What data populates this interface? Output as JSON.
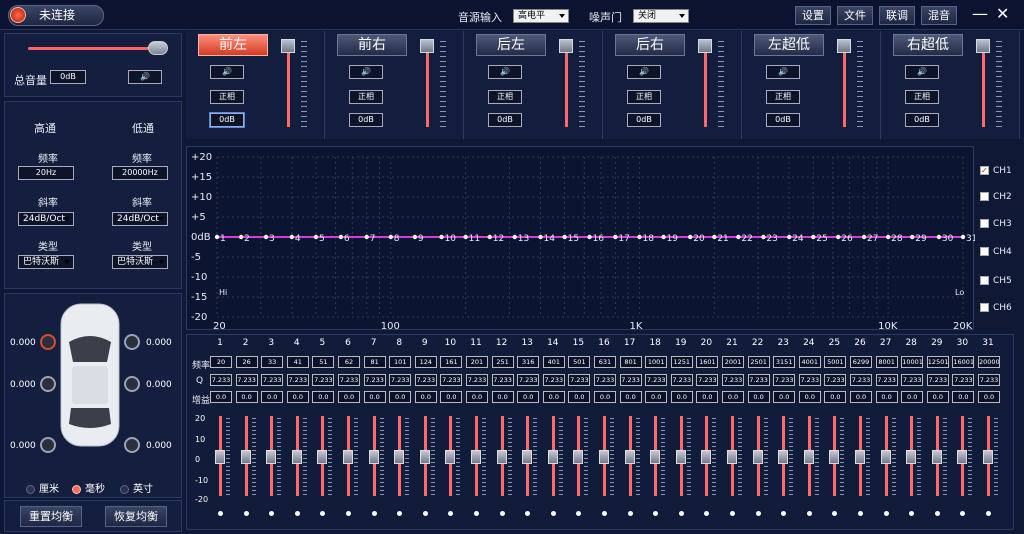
{
  "top": {
    "connection_label": "未连接",
    "source_label": "音源输入",
    "source_value": "高电平",
    "noise_label": "噪声门",
    "noise_value": "关闭",
    "buttons": [
      "设置",
      "文件",
      "联调",
      "混音"
    ],
    "minimize": "—",
    "close": "✕"
  },
  "volume": {
    "label": "总音量",
    "value": "0dB",
    "level_pct": 100
  },
  "crossover": {
    "high_title": "高通",
    "low_title": "低通",
    "freq_label": "频率",
    "high_freq": "20Hz",
    "low_freq": "20000Hz",
    "slope_label": "斜率",
    "high_slope": "24dB/Oct",
    "low_slope": "24dB/Oct",
    "type_label": "类型",
    "high_type": "巴特沃斯",
    "low_type": "巴特沃斯"
  },
  "channels": [
    {
      "name": "前左",
      "phase": "正相",
      "gain": "0dB",
      "active": true
    },
    {
      "name": "前右",
      "phase": "正相",
      "gain": "0dB",
      "active": false
    },
    {
      "name": "后左",
      "phase": "正相",
      "gain": "0dB",
      "active": false
    },
    {
      "name": "后右",
      "phase": "正相",
      "gain": "0dB",
      "active": false
    },
    {
      "name": "左超低",
      "phase": "正相",
      "gain": "0dB",
      "active": false
    },
    {
      "name": "右超低",
      "phase": "正相",
      "gain": "0dB",
      "active": false
    }
  ],
  "chart_data": {
    "type": "line",
    "y_ticks": [
      "+20",
      "+15",
      "+10",
      "+5",
      "0dB",
      "-5",
      "-10",
      "-15",
      "-20"
    ],
    "x_ticks": [
      "20",
      "100",
      "1K",
      "10K",
      "20K"
    ],
    "ylim": [
      -20,
      20
    ],
    "corner_left": "Hi",
    "corner_right": "Lo",
    "points": [
      {
        "band": 1,
        "freq": 20,
        "gain": 0
      },
      {
        "band": 2,
        "freq": 25,
        "gain": 0
      },
      {
        "band": 3,
        "freq": 31.5,
        "gain": 0
      },
      {
        "band": 4,
        "freq": 40,
        "gain": 0
      },
      {
        "band": 5,
        "freq": 50,
        "gain": 0
      },
      {
        "band": 6,
        "freq": 63,
        "gain": 0
      },
      {
        "band": 7,
        "freq": 80,
        "gain": 0
      },
      {
        "band": 8,
        "freq": 100,
        "gain": 0
      },
      {
        "band": 9,
        "freq": 125,
        "gain": 0
      },
      {
        "band": 10,
        "freq": 160,
        "gain": 0
      },
      {
        "band": 11,
        "freq": 200,
        "gain": 0
      },
      {
        "band": 12,
        "freq": 250,
        "gain": 0
      },
      {
        "band": 13,
        "freq": 315,
        "gain": 0
      },
      {
        "band": 14,
        "freq": 400,
        "gain": 0
      },
      {
        "band": 15,
        "freq": 500,
        "gain": 0
      },
      {
        "band": 16,
        "freq": 630,
        "gain": 0
      },
      {
        "band": 17,
        "freq": 800,
        "gain": 0
      },
      {
        "band": 18,
        "freq": 1000,
        "gain": 0
      },
      {
        "band": 19,
        "freq": 1250,
        "gain": 0
      },
      {
        "band": 20,
        "freq": 1600,
        "gain": 0
      },
      {
        "band": 21,
        "freq": 2000,
        "gain": 0
      },
      {
        "band": 22,
        "freq": 2500,
        "gain": 0
      },
      {
        "band": 23,
        "freq": 3150,
        "gain": 0
      },
      {
        "band": 24,
        "freq": 4000,
        "gain": 0
      },
      {
        "band": 25,
        "freq": 5000,
        "gain": 0
      },
      {
        "band": 26,
        "freq": 6300,
        "gain": 0
      },
      {
        "band": 27,
        "freq": 8000,
        "gain": 0
      },
      {
        "band": 28,
        "freq": 10000,
        "gain": 0
      },
      {
        "band": 29,
        "freq": 12500,
        "gain": 0
      },
      {
        "band": 30,
        "freq": 16000,
        "gain": 0
      },
      {
        "band": 31,
        "freq": 20000,
        "gain": 0
      }
    ],
    "line_color": "#d73cd8"
  },
  "legend": [
    "CH1",
    "CH2",
    "CH3",
    "CH4",
    "CH5",
    "CH6"
  ],
  "legend_checked": [
    true,
    false,
    false,
    false,
    false,
    false
  ],
  "eq": {
    "freq_label": "频率",
    "q_label": "Q",
    "gain_label": "增益",
    "band_numbers": [
      "1",
      "2",
      "3",
      "4",
      "5",
      "6",
      "7",
      "8",
      "9",
      "10",
      "11",
      "12",
      "13",
      "14",
      "15",
      "16",
      "17",
      "18",
      "19",
      "20",
      "21",
      "22",
      "23",
      "24",
      "25",
      "26",
      "27",
      "28",
      "29",
      "30",
      "31"
    ],
    "freqs": [
      "20",
      "26",
      "33",
      "41",
      "51",
      "62",
      "81",
      "101",
      "124",
      "161",
      "201",
      "251",
      "316",
      "401",
      "501",
      "631",
      "801",
      "1001",
      "1251",
      "1601",
      "2001",
      "2501",
      "3151",
      "4001",
      "5001",
      "6299",
      "8001",
      "10001",
      "12501",
      "16001",
      "20000"
    ],
    "q": [
      "7.233",
      "7.233",
      "7.233",
      "7.233",
      "7.233",
      "7.233",
      "7.233",
      "7.233",
      "7.233",
      "7.233",
      "7.233",
      "7.233",
      "7.233",
      "7.233",
      "7.233",
      "7.233",
      "7.233",
      "7.233",
      "7.233",
      "7.233",
      "7.233",
      "7.233",
      "7.233",
      "7.233",
      "7.233",
      "7.233",
      "7.233",
      "7.233",
      "7.233",
      "7.233",
      "7.233"
    ],
    "gains": [
      "0.0",
      "0.0",
      "0.0",
      "0.0",
      "0.0",
      "0.0",
      "0.0",
      "0.0",
      "0.0",
      "0.0",
      "0.0",
      "0.0",
      "0.0",
      "0.0",
      "0.0",
      "0.0",
      "0.0",
      "0.0",
      "0.0",
      "0.0",
      "0.0",
      "0.0",
      "0.0",
      "0.0",
      "0.0",
      "0.0",
      "0.0",
      "0.0",
      "0.0",
      "0.0",
      "0.0"
    ],
    "gain_scale": [
      "20",
      "10",
      "0",
      "-10",
      "-20"
    ]
  },
  "speakers": {
    "delays": [
      "0.000",
      "0.000",
      "0.000",
      "0.000",
      "0.000",
      "0.000"
    ]
  },
  "units": {
    "cm": "厘米",
    "ms": "毫秒",
    "inch": "英寸",
    "selected": "ms"
  },
  "footer": {
    "reset": "重置均衡",
    "restore": "恢复均衡"
  }
}
